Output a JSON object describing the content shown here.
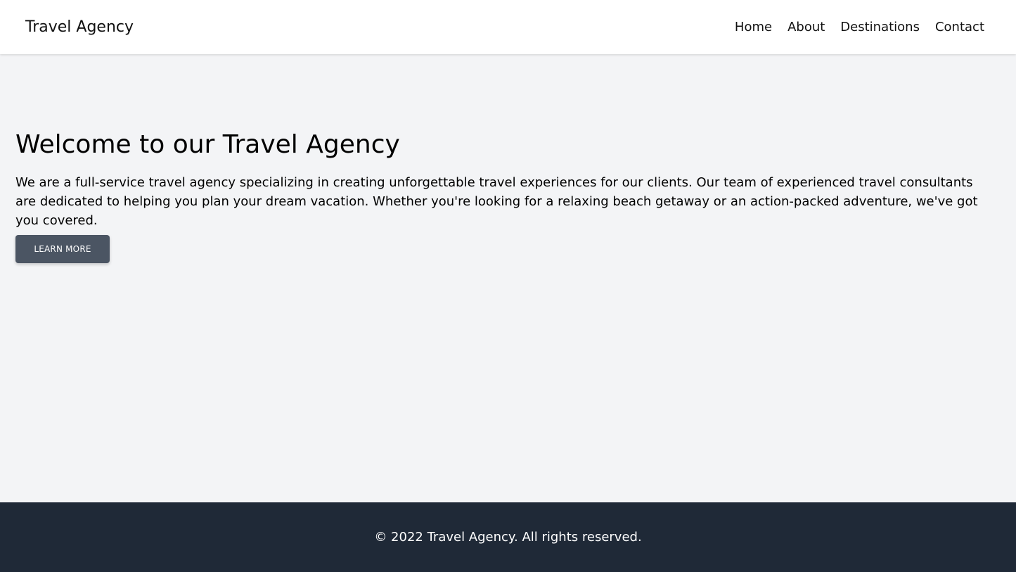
{
  "header": {
    "brand": "Travel Agency",
    "nav": [
      {
        "label": "Home"
      },
      {
        "label": "About"
      },
      {
        "label": "Destinations"
      },
      {
        "label": "Contact"
      }
    ]
  },
  "hero": {
    "title": "Welcome to our Travel Agency",
    "text": "We are a full-service travel agency specializing in creating unforgettable travel experiences for our clients. Our team of experienced travel consultants are dedicated to helping you plan your dream vacation. Whether you're looking for a relaxing beach getaway or an action-packed adventure, we've got you covered.",
    "cta_label": "LEARN MORE"
  },
  "footer": {
    "text": "© 2022 Travel Agency. All rights reserved."
  },
  "colors": {
    "page_bg": "#f3f4f6",
    "header_bg": "#ffffff",
    "button_bg": "#4b5563",
    "footer_bg": "#1f2937"
  }
}
